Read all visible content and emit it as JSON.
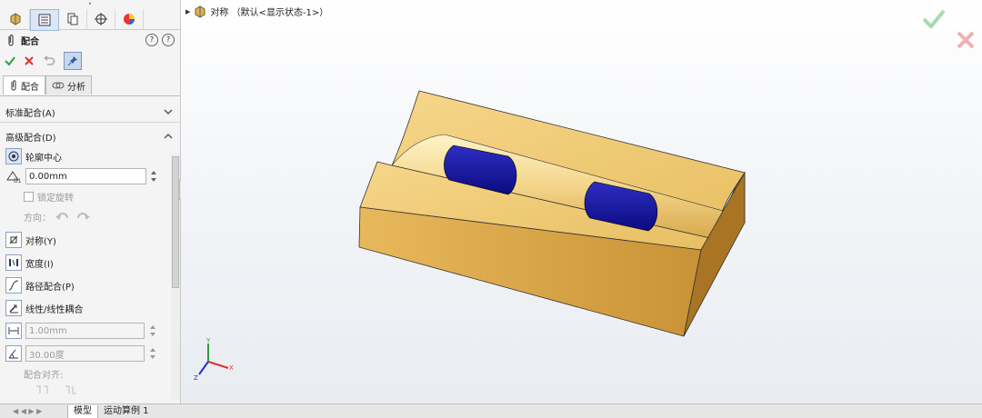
{
  "property_manager": {
    "title": "配合",
    "help1": "?",
    "help2": "?",
    "subtabs": {
      "mates": "配合",
      "analysis": "分析"
    },
    "standard_mates": "标准配合(A)",
    "advanced_mates": "高级配合(D)",
    "profile_center": "轮廓中心",
    "offset_value": "0.00mm",
    "lock_rotation": "锁定旋转",
    "direction_label": "方向：",
    "symmetric": "对称(Y)",
    "width": "宽度(I)",
    "path_mate": "路径配合(P)",
    "linear_coupler": "线性/线性耦合",
    "distance_value": "1.00mm",
    "angle_value": "30.00度",
    "mate_alignment": "配合对齐:"
  },
  "tree": {
    "label": "对称 （默认<显示状态-1>）"
  },
  "bottom_tabs": [
    "模型",
    "运动算例 1"
  ],
  "colors": {
    "block": "#e7b65a",
    "pins": "#1a1aa0",
    "accept": "#2e9e3e",
    "cancel": "#d33"
  }
}
